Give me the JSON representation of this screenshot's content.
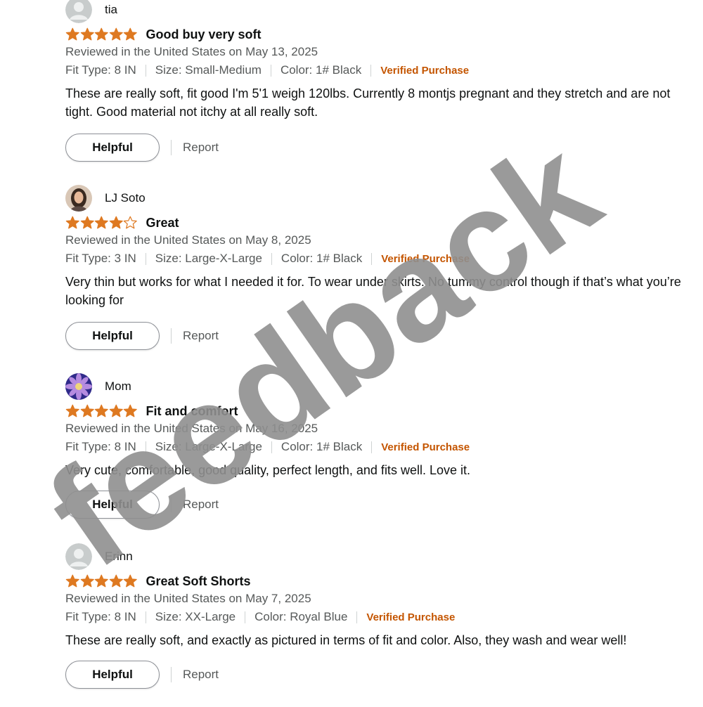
{
  "reviews": [
    {
      "reviewer": "tia",
      "avatar": "default-avatar",
      "rating": 5,
      "title": "Good buy very soft",
      "date": "Reviewed in the United States on May 13, 2025",
      "fit_type": "Fit Type: 8 IN",
      "size": "Size: Small-Medium",
      "color": "Color: 1# Black",
      "verified": "Verified Purchase",
      "body": "These are really soft, fit good I'm 5'1 weigh 120lbs. Currently 8 montjs pregnant and they stretch and are not tight. Good material not itchy at all really soft.",
      "helpful_label": "Helpful",
      "report_label": "Report"
    },
    {
      "reviewer": "LJ Soto",
      "avatar": "photo-avatar",
      "rating": 4,
      "title": "Great",
      "date": "Reviewed in the United States on May 8, 2025",
      "fit_type": "Fit Type: 3 IN",
      "size": "Size: Large-X-Large",
      "color": "Color: 1# Black",
      "verified": "Verified Purchase",
      "body": "Very thin but works for what I needed it for. To wear under skirts. No tummy control though if that’s what you’re looking for",
      "helpful_label": "Helpful",
      "report_label": "Report"
    },
    {
      "reviewer": "Mom",
      "avatar": "flower-avatar",
      "rating": 5,
      "title": "Fit and comfort",
      "date": "Reviewed in the United States on May 16, 2025",
      "fit_type": "Fit Type: 8 IN",
      "size": "Size: Large-X-Large",
      "color": "Color: 1# Black",
      "verified": "Verified Purchase",
      "body": "Very cute, comfortable, good quality, perfect length, and fits well. Love it.",
      "helpful_label": "Helpful",
      "report_label": "Report"
    },
    {
      "reviewer": "Erinn",
      "avatar": "default-avatar",
      "rating": 5,
      "title": "Great Soft Shorts",
      "date": "Reviewed in the United States on May 7, 2025",
      "fit_type": "Fit Type: 8 IN",
      "size": "Size: XX-Large",
      "color": "Color: Royal Blue",
      "verified": "Verified Purchase",
      "body": "These are really soft, and exactly as pictured in terms of fit and color. Also, they wash and wear well!",
      "helpful_label": "Helpful",
      "report_label": "Report"
    }
  ],
  "watermark": "feedback",
  "colors": {
    "star": "#de7921",
    "verified": "#c45500",
    "muted_text": "#565959",
    "watermark": "#8f8f8f"
  }
}
